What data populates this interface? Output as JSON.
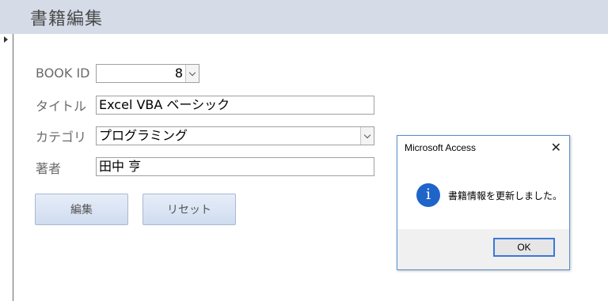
{
  "form": {
    "title": "書籍編集",
    "labels": {
      "book_id": "BOOK ID",
      "title": "タイトル",
      "category": "カテゴリ",
      "author": "著者"
    },
    "values": {
      "book_id": "8",
      "title": "Excel VBA ベーシック",
      "category": "プログラミング",
      "author": "田中 亨"
    },
    "buttons": {
      "edit": "編集",
      "reset": "リセット"
    }
  },
  "dialog": {
    "title": "Microsoft Access",
    "close": "✕",
    "icon": "info-icon",
    "icon_glyph": "i",
    "message": "書籍情報を更新しました。",
    "ok_label": "OK"
  },
  "colors": {
    "header_bg": "#d5dce8",
    "button_bg": "#cfdcf0",
    "dialog_border": "#5a8ed0",
    "info_icon": "#1f64c8"
  }
}
